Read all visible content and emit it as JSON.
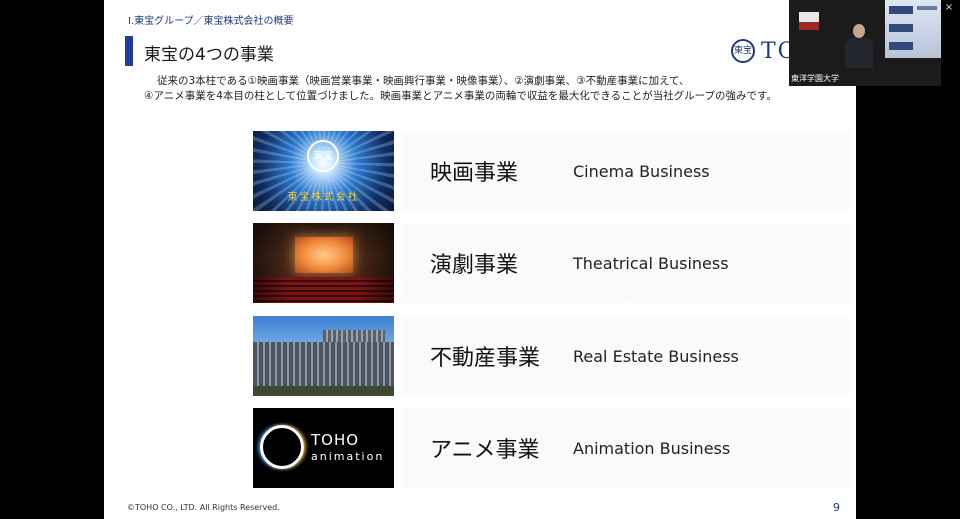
{
  "slide": {
    "breadcrumb": "Ⅰ.東宝グループ／東宝株式会社の概要",
    "title": "東宝の4つの事業",
    "logo": {
      "emblem": "東宝",
      "text": "TOHO"
    },
    "description": [
      "従来の3本柱である①映画事業（映画営業事業・映画興行事業・映像事業）、②演劇事業、③不動産事業に加えて、",
      "④アニメ事業を4本目の柱として位置づけました。映画事業とアニメ事業の両輪で収益を最大化できることが当社グループの強みです。"
    ],
    "businesses": [
      {
        "jp": "映画事業",
        "en": "Cinema Business",
        "thumb_caption": "東宝株式会社",
        "emblem": "東宝"
      },
      {
        "jp": "演劇事業",
        "en": "Theatrical Business"
      },
      {
        "jp": "不動産事業",
        "en": "Real Estate Business"
      },
      {
        "jp": "アニメ事業",
        "en": "Animation Business",
        "brand_line1": "TOHO",
        "brand_line2": "animation"
      }
    ],
    "footer": "©TOHO CO., LTD. All Rights Reserved.",
    "page_number": "9"
  },
  "video": {
    "participant_label": "東洋学園大学"
  },
  "window": {
    "close_glyph": "×"
  }
}
